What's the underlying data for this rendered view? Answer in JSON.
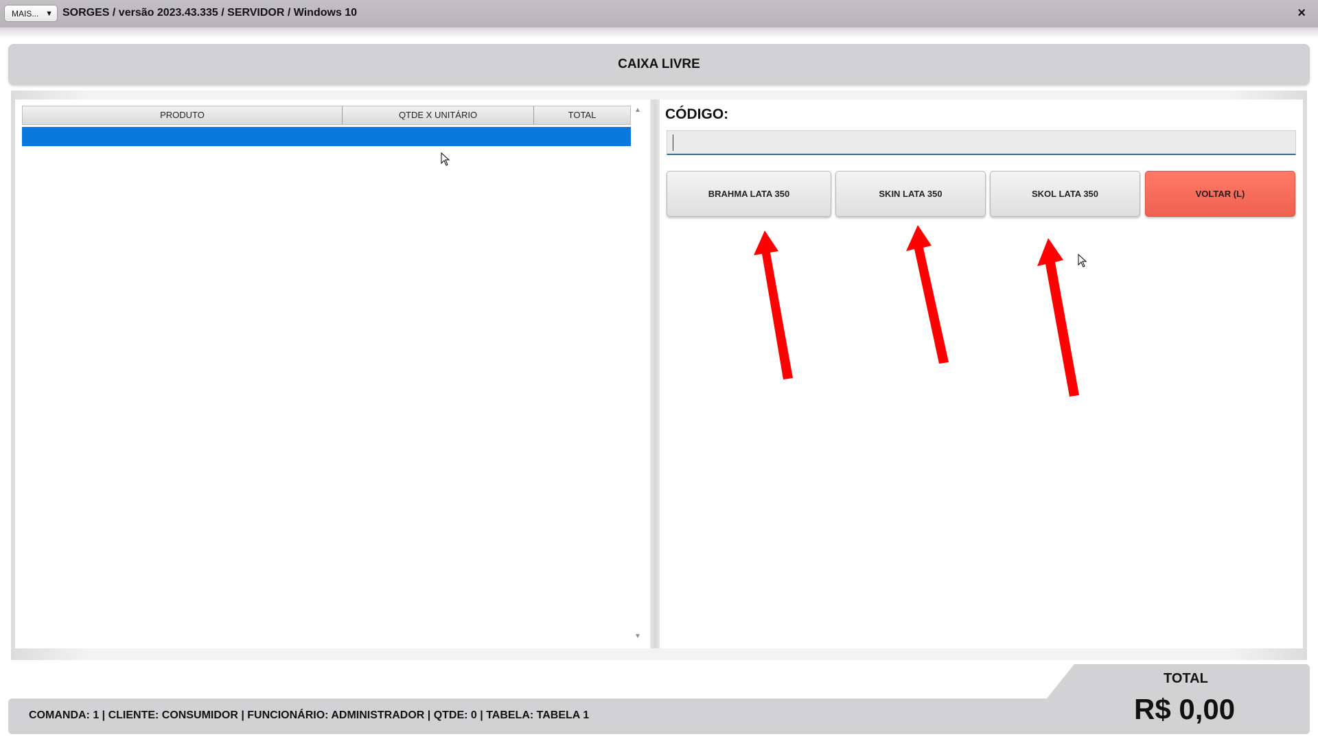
{
  "window": {
    "mais_label": "MAIS...",
    "mais_arrow": "▼",
    "title": "SORGES / versão 2023.43.335 / SERVIDOR / Windows 10",
    "close_icon": "×"
  },
  "status": {
    "caixa": "CAIXA LIVRE"
  },
  "grid": {
    "columns": [
      "PRODUTO",
      "QTDE X UNITÁRIO",
      "TOTAL"
    ],
    "scroll_up": "▲",
    "scroll_down": "▼"
  },
  "entry": {
    "codigo_label": "CÓDIGO:",
    "codigo_value": ""
  },
  "buttons": {
    "b1": "BRAHMA LATA 350",
    "b2": "SKIN LATA 350",
    "b3": "SKOL LATA 350",
    "voltar": "VOLTAR (L)"
  },
  "footer": {
    "info": "COMANDA: 1  |  CLIENTE: CONSUMIDOR  |  FUNCIONÁRIO: ADMINISTRADOR  |  QTDE: 0  |  TABELA: TABELA 1",
    "total_label": "TOTAL",
    "total_value": "R$ 0,00"
  },
  "colors": {
    "selection": "#0a78de",
    "voltar": "#f0604f",
    "annotation_arrow": "#ff0000"
  }
}
